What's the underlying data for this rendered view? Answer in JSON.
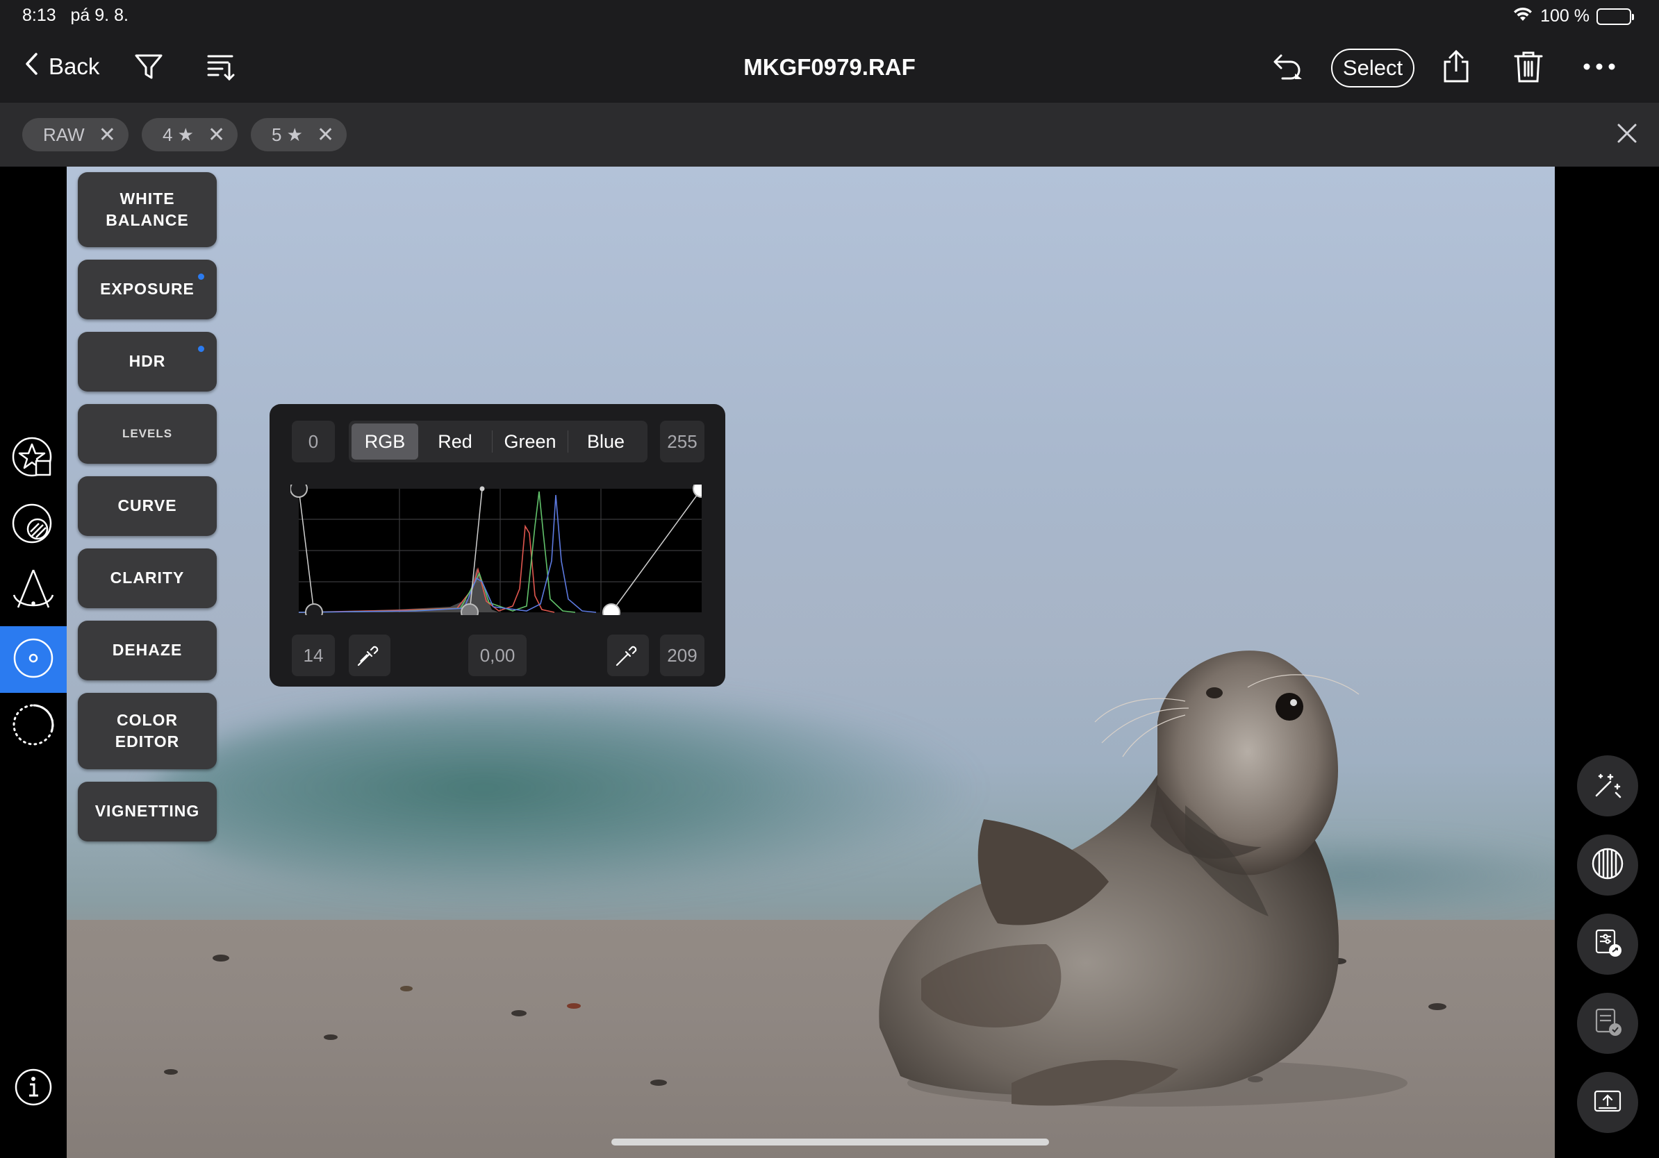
{
  "status_bar": {
    "time": "8:13",
    "date": "pá 9. 8.",
    "battery_text": "100 %"
  },
  "nav": {
    "back_label": "Back",
    "title": "MKGF0979.RAF",
    "select_label": "Select"
  },
  "filters": {
    "chips": [
      {
        "label": "RAW"
      },
      {
        "label": "4 ★"
      },
      {
        "label": "5 ★"
      }
    ]
  },
  "left_rail": {
    "icons": [
      "star-square-icon",
      "mask-circle-icon",
      "perspective-icon",
      "levels-tool-icon",
      "dotted-circle-icon",
      "info-icon"
    ],
    "active": "levels-tool-icon"
  },
  "adjustments": {
    "white_balance": "WHITE\nBALANCE",
    "exposure": "EXPOSURE",
    "hdr": "HDR",
    "levels": "LEVELS",
    "curve": "CURVE",
    "clarity": "CLARITY",
    "dehaze": "DEHAZE",
    "color_editor": "COLOR\nEDITOR",
    "vignetting": "VIGNETTING",
    "modified_indicator_color": "#2b7bf0"
  },
  "levels_panel": {
    "input_black": "0",
    "input_white": "255",
    "channels": [
      "RGB",
      "Red",
      "Green",
      "Blue"
    ],
    "active_channel": "RGB",
    "output_black": "14",
    "gamma": "0,00",
    "output_white": "209"
  },
  "right_rail": {
    "icons": [
      "magic-wand-icon",
      "lens-filter-icon",
      "copy-adjustments-icon",
      "paste-adjustments-icon",
      "export-icon"
    ]
  },
  "colors": {
    "accent": "#2b7bf0",
    "bar_bg": "#1c1c1e",
    "chip_bar": "#2c2c2e"
  }
}
